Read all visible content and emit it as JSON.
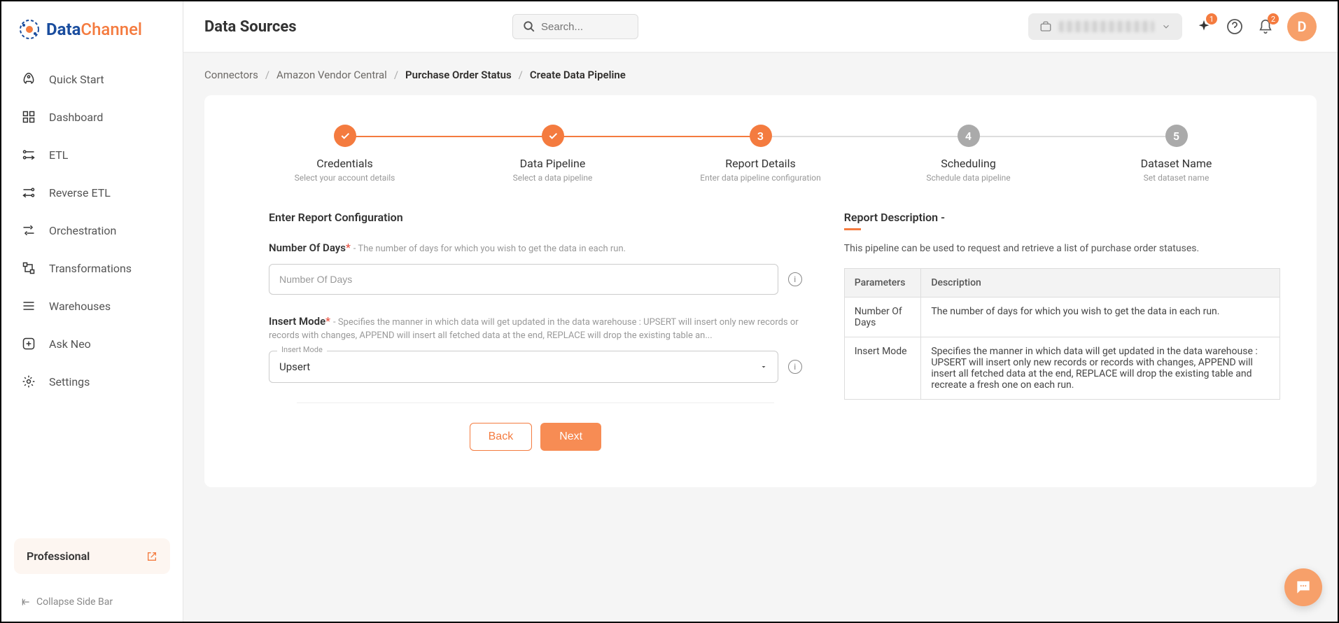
{
  "brand": {
    "data": "Data",
    "channel": "Channel"
  },
  "sidebar": {
    "items": [
      {
        "label": "Quick Start"
      },
      {
        "label": "Dashboard"
      },
      {
        "label": "ETL"
      },
      {
        "label": "Reverse ETL"
      },
      {
        "label": "Orchestration"
      },
      {
        "label": "Transformations"
      },
      {
        "label": "Warehouses"
      },
      {
        "label": "Ask Neo"
      },
      {
        "label": "Settings"
      }
    ],
    "plan": "Professional",
    "collapse": "Collapse Side Bar"
  },
  "header": {
    "title": "Data Sources",
    "search_placeholder": "Search...",
    "sparkle_badge": "1",
    "bell_badge": "2",
    "avatar_letter": "D"
  },
  "breadcrumb": {
    "items": [
      "Connectors",
      "Amazon Vendor Central",
      "Purchase Order Status",
      "Create Data Pipeline"
    ],
    "active_from": 2
  },
  "stepper": [
    {
      "title": "Credentials",
      "sub": "Select your account details",
      "state": "done"
    },
    {
      "title": "Data Pipeline",
      "sub": "Select a data pipeline",
      "state": "done"
    },
    {
      "title": "Report Details",
      "sub": "Enter data pipeline configuration",
      "state": "active",
      "num": "3"
    },
    {
      "title": "Scheduling",
      "sub": "Schedule data pipeline",
      "state": "pending",
      "num": "4"
    },
    {
      "title": "Dataset Name",
      "sub": "Set dataset name",
      "state": "pending",
      "num": "5"
    }
  ],
  "form": {
    "section_title": "Enter Report Configuration",
    "days": {
      "label": "Number Of Days",
      "help": "- The number of days for which you wish to get the data in each run.",
      "placeholder": "Number Of Days"
    },
    "insert": {
      "label": "Insert Mode",
      "help": "- Specifies the manner in which data will get updated in the data warehouse : UPSERT will insert only new records or records with changes, APPEND will insert all fetched data at the end, REPLACE will drop the existing table an...",
      "float_label": "Insert Mode",
      "value": "Upsert"
    },
    "back": "Back",
    "next": "Next"
  },
  "description": {
    "title": "Report Description -",
    "text": "This pipeline can be used to request and retrieve a list of purchase order statuses.",
    "table": {
      "headers": [
        "Parameters",
        "Description"
      ],
      "rows": [
        [
          "Number Of Days",
          "The number of days for which you wish to get the data in each run."
        ],
        [
          "Insert Mode",
          "Specifies the manner in which data will get updated in the data warehouse : UPSERT will insert only new records or records with changes, APPEND will insert all fetched data at the end, REPLACE will drop the existing table and recreate a fresh one on each run."
        ]
      ]
    }
  }
}
